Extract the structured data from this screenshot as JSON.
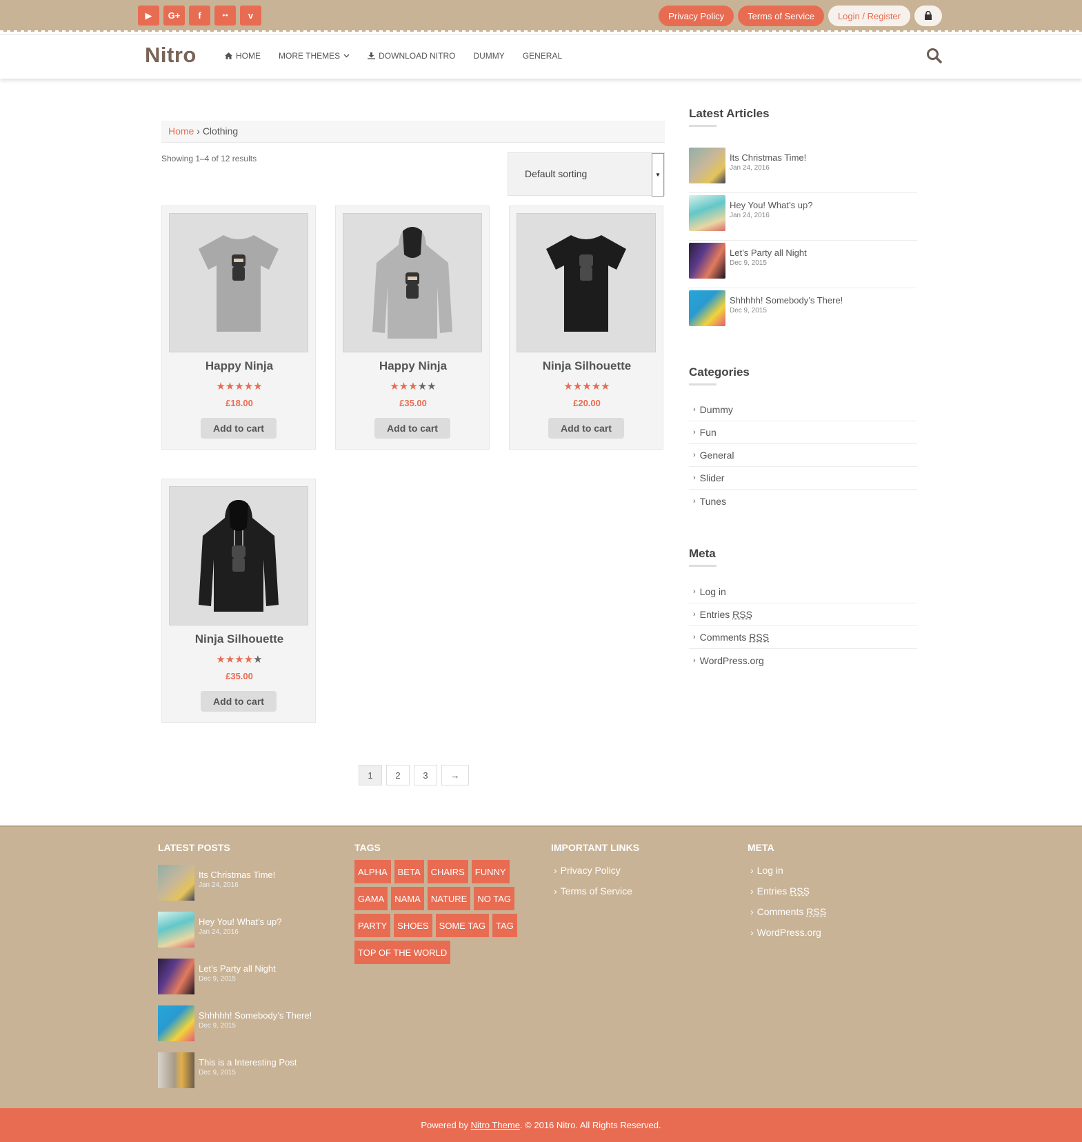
{
  "topbar": {
    "social": [
      {
        "icon": "youtube-icon",
        "glyph": "▶"
      },
      {
        "icon": "google-plus-icon",
        "glyph": "G+"
      },
      {
        "icon": "facebook-icon",
        "glyph": "f"
      },
      {
        "icon": "flickr-icon",
        "glyph": "●●"
      },
      {
        "icon": "vimeo-icon",
        "glyph": "v"
      }
    ],
    "privacy": "Privacy Policy",
    "terms": "Terms of Service",
    "login": "Login / Register"
  },
  "nav": {
    "logo": "Nitro",
    "home": "HOME",
    "more_themes": "MORE THEMES",
    "download": "DOWNLOAD NITRO",
    "dummy": "DUMMY",
    "general": "GENERAL"
  },
  "main": {
    "breadcrumb_home": "Home",
    "breadcrumb_sep": "›",
    "breadcrumb_current": "Clothing",
    "result_count": "Showing 1–4 of 12 results",
    "sorting": "Default sorting",
    "products": [
      {
        "name": "Happy Ninja",
        "price": "£18.00",
        "button": "Add to cart",
        "rating": 4.5
      },
      {
        "name": "Happy Ninja",
        "price": "£35.00",
        "button": "Add to cart",
        "rating": 2.5
      },
      {
        "name": "Ninja Silhouette",
        "price": "£20.00",
        "button": "Add to cart",
        "rating": 5
      },
      {
        "name": "Ninja Silhouette",
        "price": "£35.00",
        "button": "Add to cart",
        "rating": 4
      }
    ],
    "pager": [
      "1",
      "2",
      "3",
      "→"
    ]
  },
  "sidebar": {
    "latest_title": "Latest Articles",
    "articles": [
      {
        "title": "Its Christmas Time!",
        "date": "Jan 24, 2016"
      },
      {
        "title": "Hey You! What’s up?",
        "date": "Jan 24, 2016"
      },
      {
        "title": "Let’s Party all Night",
        "date": "Dec 9, 2015"
      },
      {
        "title": "Shhhhh! Somebody’s There!",
        "date": "Dec 9, 2015"
      }
    ],
    "categories_title": "Categories",
    "categories": [
      "Dummy",
      "Fun",
      "General",
      "Slider",
      "Tunes"
    ],
    "meta_title": "Meta",
    "meta": {
      "login": "Log in",
      "entries": "Entries",
      "comments": "Comments",
      "rss": "RSS",
      "wordpress": "WordPress.org"
    }
  },
  "footer": {
    "latest_title": "LATEST POSTS",
    "posts": [
      {
        "title": "Its Christmas Time!",
        "date": "Jan 24, 2016"
      },
      {
        "title": "Hey You! What’s up?",
        "date": "Jan 24, 2016"
      },
      {
        "title": "Let’s Party all Night",
        "date": "Dec 9, 2015"
      },
      {
        "title": "Shhhhh! Somebody’s There!",
        "date": "Dec 9, 2015"
      },
      {
        "title": "This is a Interesting Post",
        "date": "Dec 9, 2015"
      }
    ],
    "tags_title": "TAGS",
    "tags": [
      "ALPHA",
      "BETA",
      "CHAIRS",
      "FUNNY",
      "GAMA",
      "NAMA",
      "NATURE",
      "NO TAG",
      "PARTY",
      "SHOES",
      "SOME TAG",
      "TAG",
      "TOP OF THE WORLD"
    ],
    "links_title": "IMPORTANT LINKS",
    "links": [
      "Privacy Policy",
      "Terms of Service"
    ],
    "meta_title": "META",
    "meta": {
      "login": "Log in",
      "entries": "Entries",
      "comments": "Comments",
      "rss": "RSS",
      "wordpress": "WordPress.org"
    }
  },
  "copyright": {
    "prefix": "Powered by",
    "link": "Nitro Theme",
    "suffix": ". © 2016 Nitro. All Rights Reserved."
  },
  "colors": {
    "accent": "#e86c52",
    "tan": "#c9b396"
  }
}
